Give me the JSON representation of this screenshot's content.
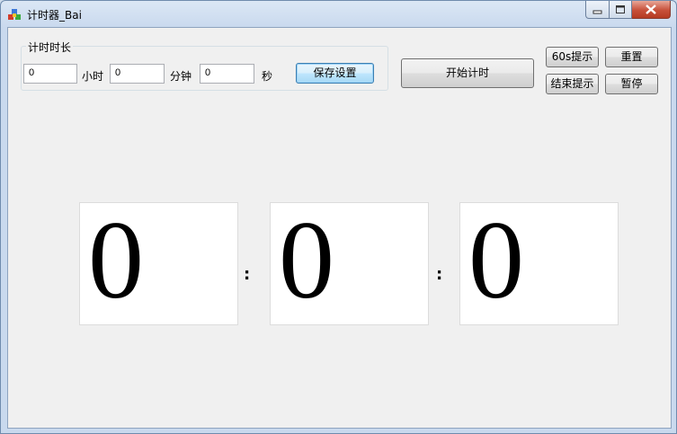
{
  "window": {
    "title": "计时器_Bai"
  },
  "duration_group": {
    "legend": "计时时长",
    "hours_value": "0",
    "hours_label": "小时",
    "minutes_value": "0",
    "minutes_label": "分钟",
    "seconds_value": "0",
    "seconds_label": "秒",
    "save_label": "保存设置"
  },
  "controls": {
    "start_label": "开始计时",
    "warn60_label": "60s提示",
    "reset_label": "重置",
    "end_alert_label": "结束提示",
    "pause_label": "暂停"
  },
  "display": {
    "hours": "0",
    "minutes": "0",
    "seconds": "0",
    "separator": ":"
  }
}
